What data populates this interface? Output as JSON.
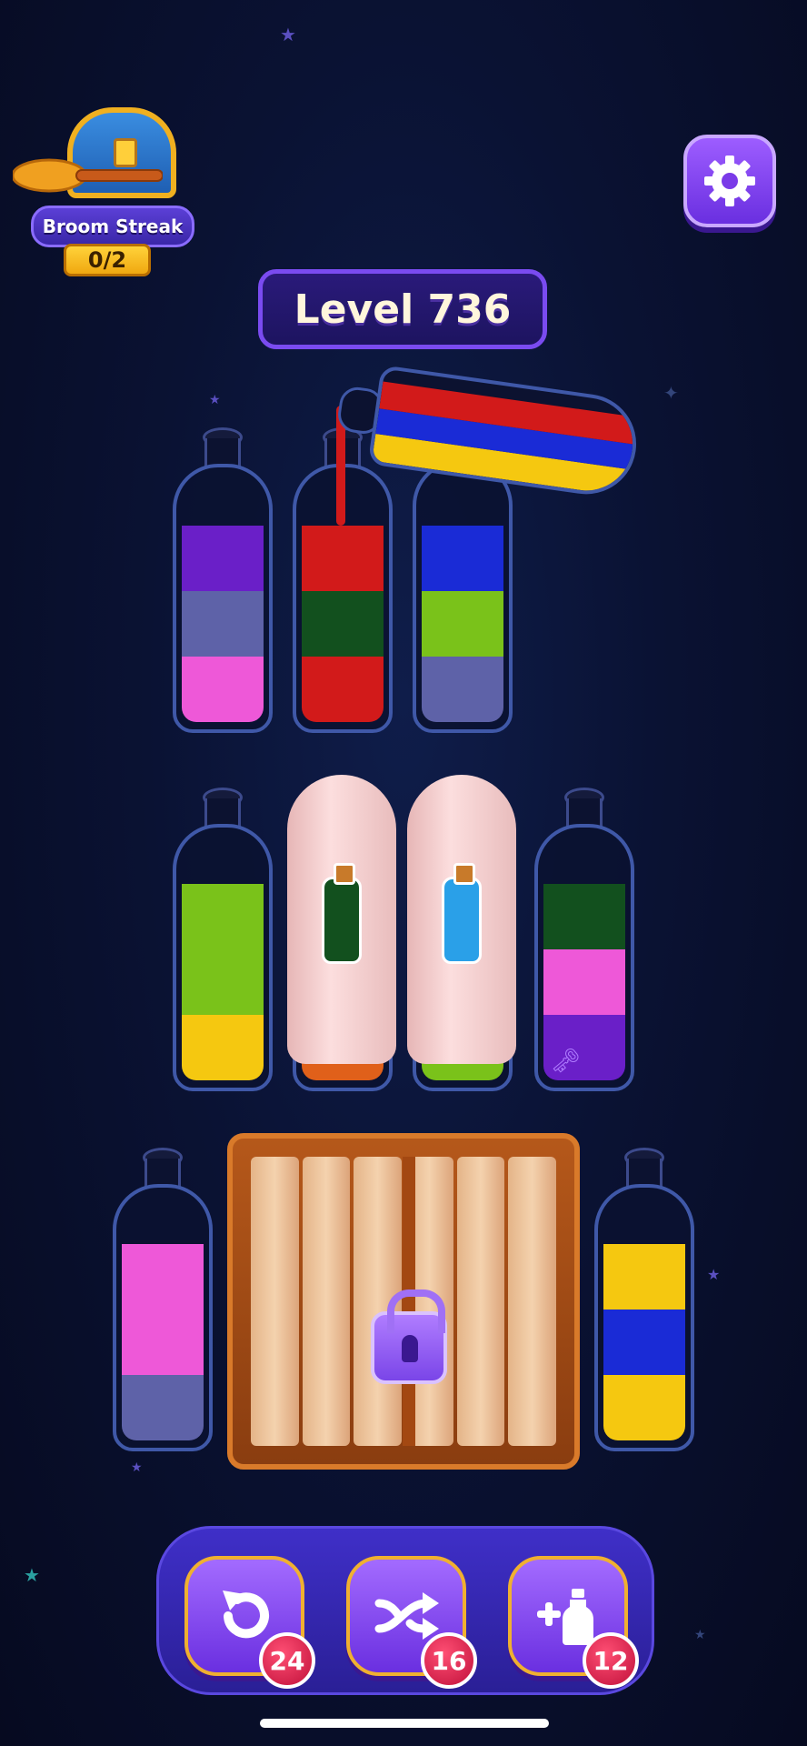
{
  "broom_streak": {
    "label": "Broom Streak",
    "count": "0/2"
  },
  "level": {
    "label": "Level 736"
  },
  "icons": {
    "settings": "gear-icon",
    "undo": "undo-icon",
    "shuffle": "shuffle-icon",
    "add_bottle": "add-bottle-icon",
    "lock": "padlock-icon",
    "key": "key-icon"
  },
  "colors": {
    "purple": "#6a1fc8",
    "slate": "#5e62a8",
    "pink": "#ee58d8",
    "red": "#d21a1a",
    "dark_green": "#12501e",
    "blue": "#1a2bd6",
    "lime": "#7ac21a",
    "yellow": "#f5c810",
    "orange": "#e0601a",
    "cyan": "#2aa0e8"
  },
  "bottles": [
    {
      "id": "bottle-1",
      "layers_bottom_to_top": [
        "pink",
        "slate",
        "purple"
      ]
    },
    {
      "id": "bottle-2",
      "layers_bottom_to_top": [
        "red",
        "dark_green",
        "red"
      ]
    },
    {
      "id": "bottle-3",
      "layers_bottom_to_top": [
        "slate",
        "lime",
        "blue"
      ]
    },
    {
      "id": "bottle-4",
      "layers_bottom_to_top": [
        "yellow",
        "lime",
        "lime"
      ]
    },
    {
      "id": "bottle-5",
      "hidden": true,
      "hint_color": "dark_green",
      "visible_bottom": "orange"
    },
    {
      "id": "bottle-6",
      "hidden": true,
      "hint_color": "cyan",
      "visible_bottom": "lime"
    },
    {
      "id": "bottle-7",
      "layers_bottom_to_top": [
        "purple",
        "pink",
        "dark_green"
      ],
      "has_key": true
    },
    {
      "id": "bottle-8",
      "layers_bottom_to_top": [
        "slate",
        "pink",
        "pink"
      ]
    },
    {
      "id": "bottle-9",
      "layers_bottom_to_top": [
        "yellow",
        "blue",
        "yellow"
      ]
    }
  ],
  "pouring_bottle": {
    "layers": [
      "yellow",
      "blue",
      "red"
    ]
  },
  "toolbar": {
    "undo_count": "24",
    "shuffle_count": "16",
    "add_bottle_count": "12"
  }
}
